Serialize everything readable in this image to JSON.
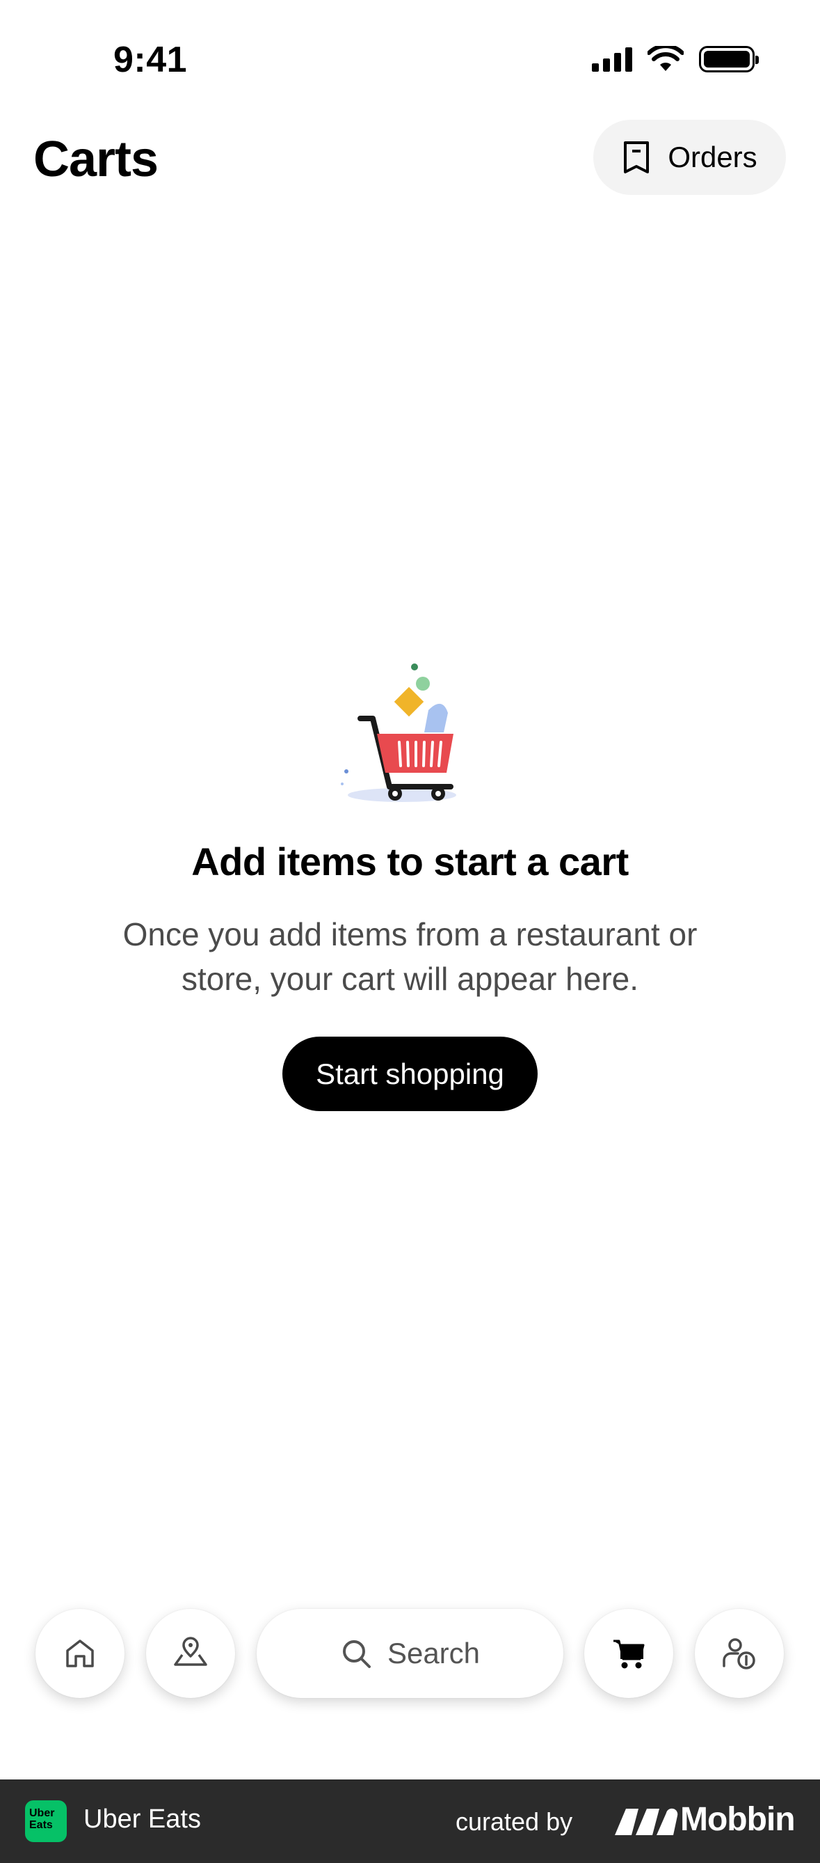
{
  "status_bar": {
    "time": "9:41"
  },
  "header": {
    "title": "Carts",
    "orders_label": "Orders"
  },
  "empty_state": {
    "title": "Add items to start a cart",
    "description": "Once you add items from a restaurant or store, your cart will appear here.",
    "button_label": "Start shopping"
  },
  "bottom_nav": {
    "search_label": "Search",
    "items": [
      "home-icon",
      "map-pin-icon",
      "search-icon",
      "cart-icon",
      "account-icon"
    ],
    "active": "cart"
  },
  "footer": {
    "logo_text": "Uber Eats",
    "app_name": "Uber Eats",
    "curated_by": "curated by",
    "brand": "Mobbin"
  },
  "colors": {
    "accent": "#000000",
    "orders_bg": "#f3f3f3",
    "footer_bg": "#2b2b2b",
    "logo_green": "#06c167",
    "cart_red": "#e84a4f"
  }
}
